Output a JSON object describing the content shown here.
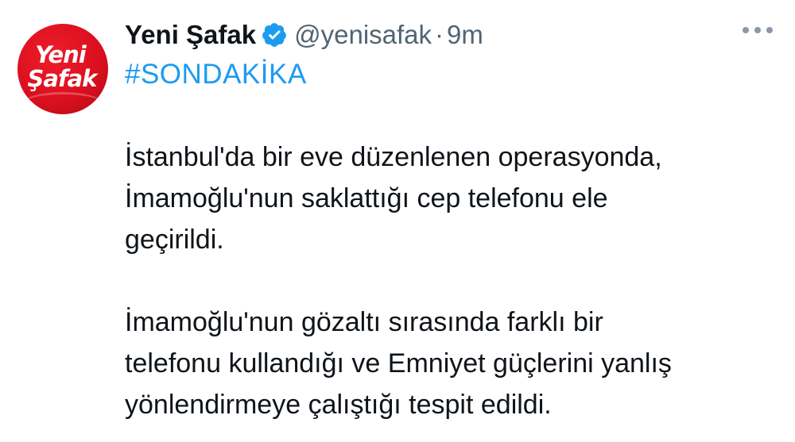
{
  "tweet": {
    "avatar_logo": {
      "line1": "Yeni",
      "line2": "Şafak",
      "bg_color": "#d80f1e"
    },
    "display_name": "Yeni Şafak",
    "verified_icon": "verified-badge-icon",
    "handle": "@yenisafak",
    "separator": "·",
    "time": "9m",
    "more_icon": "more-options-icon",
    "hashtag": "#SONDAKİKA",
    "hashtag_color": "#1d9bf0",
    "paragraphs": [
      {
        "lines": [
          "İstanbul'da bir eve düzenlenen operasyonda,",
          "İmamoğlu'nun saklattığı cep telefonu ele",
          "geçirildi."
        ]
      },
      {
        "lines": [
          "İmamoğlu'nun gözaltı sırasında farklı bir",
          "telefonu kullandığı ve Emniyet güçlerini yanlış",
          "yönlendirmeye çalıştığı tespit edildi."
        ]
      }
    ]
  }
}
